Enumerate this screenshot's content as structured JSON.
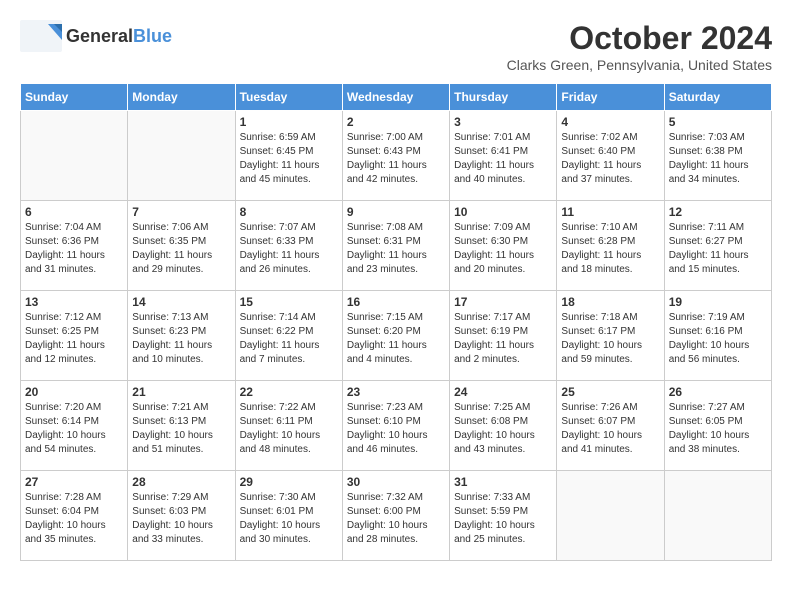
{
  "header": {
    "logo_general": "General",
    "logo_blue": "Blue",
    "month_title": "October 2024",
    "location": "Clarks Green, Pennsylvania, United States"
  },
  "days_of_week": [
    "Sunday",
    "Monday",
    "Tuesday",
    "Wednesday",
    "Thursday",
    "Friday",
    "Saturday"
  ],
  "weeks": [
    [
      {
        "day": "",
        "info": ""
      },
      {
        "day": "",
        "info": ""
      },
      {
        "day": "1",
        "info": "Sunrise: 6:59 AM\nSunset: 6:45 PM\nDaylight: 11 hours and 45 minutes."
      },
      {
        "day": "2",
        "info": "Sunrise: 7:00 AM\nSunset: 6:43 PM\nDaylight: 11 hours and 42 minutes."
      },
      {
        "day": "3",
        "info": "Sunrise: 7:01 AM\nSunset: 6:41 PM\nDaylight: 11 hours and 40 minutes."
      },
      {
        "day": "4",
        "info": "Sunrise: 7:02 AM\nSunset: 6:40 PM\nDaylight: 11 hours and 37 minutes."
      },
      {
        "day": "5",
        "info": "Sunrise: 7:03 AM\nSunset: 6:38 PM\nDaylight: 11 hours and 34 minutes."
      }
    ],
    [
      {
        "day": "6",
        "info": "Sunrise: 7:04 AM\nSunset: 6:36 PM\nDaylight: 11 hours and 31 minutes."
      },
      {
        "day": "7",
        "info": "Sunrise: 7:06 AM\nSunset: 6:35 PM\nDaylight: 11 hours and 29 minutes."
      },
      {
        "day": "8",
        "info": "Sunrise: 7:07 AM\nSunset: 6:33 PM\nDaylight: 11 hours and 26 minutes."
      },
      {
        "day": "9",
        "info": "Sunrise: 7:08 AM\nSunset: 6:31 PM\nDaylight: 11 hours and 23 minutes."
      },
      {
        "day": "10",
        "info": "Sunrise: 7:09 AM\nSunset: 6:30 PM\nDaylight: 11 hours and 20 minutes."
      },
      {
        "day": "11",
        "info": "Sunrise: 7:10 AM\nSunset: 6:28 PM\nDaylight: 11 hours and 18 minutes."
      },
      {
        "day": "12",
        "info": "Sunrise: 7:11 AM\nSunset: 6:27 PM\nDaylight: 11 hours and 15 minutes."
      }
    ],
    [
      {
        "day": "13",
        "info": "Sunrise: 7:12 AM\nSunset: 6:25 PM\nDaylight: 11 hours and 12 minutes."
      },
      {
        "day": "14",
        "info": "Sunrise: 7:13 AM\nSunset: 6:23 PM\nDaylight: 11 hours and 10 minutes."
      },
      {
        "day": "15",
        "info": "Sunrise: 7:14 AM\nSunset: 6:22 PM\nDaylight: 11 hours and 7 minutes."
      },
      {
        "day": "16",
        "info": "Sunrise: 7:15 AM\nSunset: 6:20 PM\nDaylight: 11 hours and 4 minutes."
      },
      {
        "day": "17",
        "info": "Sunrise: 7:17 AM\nSunset: 6:19 PM\nDaylight: 11 hours and 2 minutes."
      },
      {
        "day": "18",
        "info": "Sunrise: 7:18 AM\nSunset: 6:17 PM\nDaylight: 10 hours and 59 minutes."
      },
      {
        "day": "19",
        "info": "Sunrise: 7:19 AM\nSunset: 6:16 PM\nDaylight: 10 hours and 56 minutes."
      }
    ],
    [
      {
        "day": "20",
        "info": "Sunrise: 7:20 AM\nSunset: 6:14 PM\nDaylight: 10 hours and 54 minutes."
      },
      {
        "day": "21",
        "info": "Sunrise: 7:21 AM\nSunset: 6:13 PM\nDaylight: 10 hours and 51 minutes."
      },
      {
        "day": "22",
        "info": "Sunrise: 7:22 AM\nSunset: 6:11 PM\nDaylight: 10 hours and 48 minutes."
      },
      {
        "day": "23",
        "info": "Sunrise: 7:23 AM\nSunset: 6:10 PM\nDaylight: 10 hours and 46 minutes."
      },
      {
        "day": "24",
        "info": "Sunrise: 7:25 AM\nSunset: 6:08 PM\nDaylight: 10 hours and 43 minutes."
      },
      {
        "day": "25",
        "info": "Sunrise: 7:26 AM\nSunset: 6:07 PM\nDaylight: 10 hours and 41 minutes."
      },
      {
        "day": "26",
        "info": "Sunrise: 7:27 AM\nSunset: 6:05 PM\nDaylight: 10 hours and 38 minutes."
      }
    ],
    [
      {
        "day": "27",
        "info": "Sunrise: 7:28 AM\nSunset: 6:04 PM\nDaylight: 10 hours and 35 minutes."
      },
      {
        "day": "28",
        "info": "Sunrise: 7:29 AM\nSunset: 6:03 PM\nDaylight: 10 hours and 33 minutes."
      },
      {
        "day": "29",
        "info": "Sunrise: 7:30 AM\nSunset: 6:01 PM\nDaylight: 10 hours and 30 minutes."
      },
      {
        "day": "30",
        "info": "Sunrise: 7:32 AM\nSunset: 6:00 PM\nDaylight: 10 hours and 28 minutes."
      },
      {
        "day": "31",
        "info": "Sunrise: 7:33 AM\nSunset: 5:59 PM\nDaylight: 10 hours and 25 minutes."
      },
      {
        "day": "",
        "info": ""
      },
      {
        "day": "",
        "info": ""
      }
    ]
  ]
}
